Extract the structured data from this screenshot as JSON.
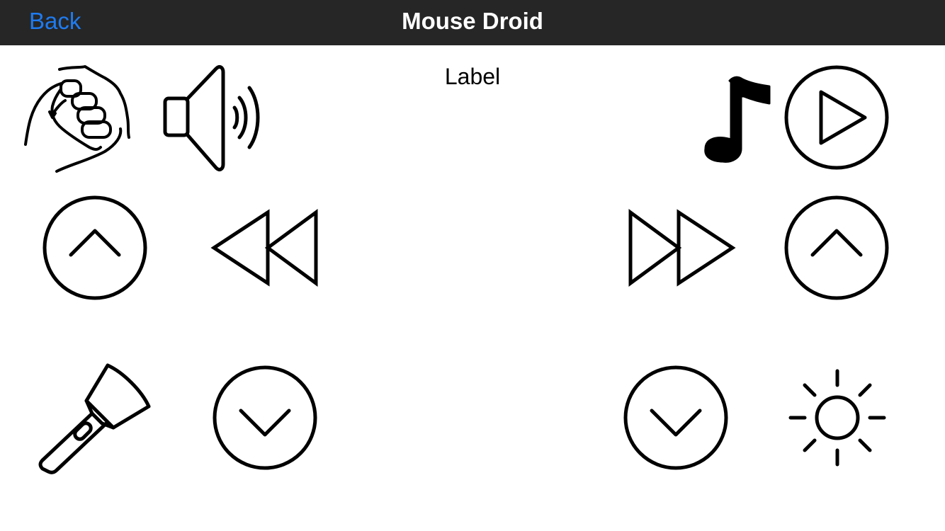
{
  "navbar": {
    "back_label": "Back",
    "title": "Mouse Droid"
  },
  "main": {
    "label": "Label"
  },
  "buttons": [
    {
      "name": "punch-icon"
    },
    {
      "name": "speaker-icon"
    },
    {
      "name": "music-note-icon"
    },
    {
      "name": "play-icon"
    },
    {
      "name": "scroll-up-left-icon"
    },
    {
      "name": "rewind-icon"
    },
    {
      "name": "fast-forward-icon"
    },
    {
      "name": "scroll-up-right-icon"
    },
    {
      "name": "flashlight-icon"
    },
    {
      "name": "scroll-down-left-icon"
    },
    {
      "name": "scroll-down-right-icon"
    },
    {
      "name": "brightness-icon"
    }
  ],
  "colors": {
    "navbar_bg": "#262626",
    "accent": "#1e7bf0",
    "icon_stroke": "#000000"
  }
}
